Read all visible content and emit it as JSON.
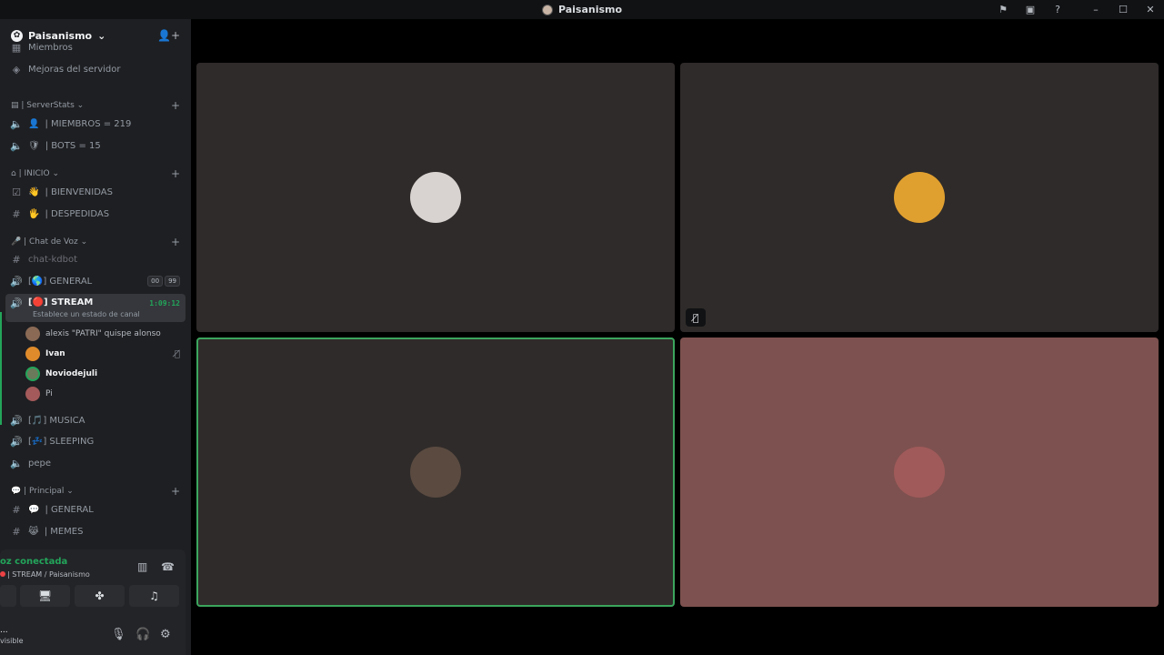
{
  "window": {
    "title": "Paisanismo"
  },
  "server": {
    "name": "Paisanismo"
  },
  "sidebar": {
    "top_partial": "Miembros",
    "boost": "Mejoras del servidor",
    "categories": [
      {
        "name": "| ServerStats",
        "channels": [
          {
            "label": "| MIEMBROS = 219",
            "emoji": "👤",
            "icon": "speaker-lock-icon"
          },
          {
            "label": "| BOTS = 15",
            "emoji": "🛡",
            "icon": "speaker-lock-icon"
          }
        ]
      },
      {
        "name": "| INICIO",
        "channels": [
          {
            "label": "| BIENVENIDAS",
            "emoji": "👋",
            "icon": "rules-icon"
          },
          {
            "label": "| DESPEDIDAS",
            "emoji": "🖐",
            "icon": "hash-icon"
          }
        ]
      },
      {
        "name": "| Chat de Voz",
        "channels": [
          {
            "label": "chat-kdbot",
            "icon": "hash-icon"
          },
          {
            "label": "[🌎] GENERAL",
            "icon": "speaker-icon",
            "badges": [
              "00",
              "99"
            ]
          },
          {
            "label": "[🔴] STREAM",
            "icon": "speaker-active-icon",
            "status": "Establece un estado de canal",
            "time": "1:09:12"
          },
          {
            "label": "[🎵] MUSICA",
            "icon": "speaker-icon"
          },
          {
            "label": "[💤] SLEEPING",
            "icon": "speaker-icon"
          },
          {
            "label": "pepe",
            "icon": "speaker-lock-icon"
          }
        ]
      },
      {
        "name": "| Principal",
        "channels": [
          {
            "label": "| GENERAL",
            "emoji": "💬",
            "icon": "hash-icon"
          },
          {
            "label": "| MEMES",
            "emoji": "😹",
            "icon": "hash-icon"
          }
        ]
      }
    ],
    "voice_members": [
      {
        "name": "alexis \"PATRI\" quispe alonso",
        "color": "#8a6a55"
      },
      {
        "name": "Ivan",
        "color": "#e08b2b",
        "muted": true
      },
      {
        "name": "Noviodejuli",
        "color": "#6a7a5a"
      },
      {
        "name": "Pi",
        "color": "#a45a5a"
      }
    ]
  },
  "voice_panel": {
    "status": "oz conectada",
    "location": "| STREAM / Paisanismo"
  },
  "user_panel": {
    "name": "...",
    "state": "visible"
  },
  "stage": {
    "tiles": [
      {
        "avatar_color": "#d8d3d0",
        "speaking": false,
        "muted": false,
        "bg": "#2f2b2a"
      },
      {
        "avatar_color": "#e0a030",
        "speaking": false,
        "muted": true,
        "bg": "#2f2b2a"
      },
      {
        "avatar_color": "#5a4a40",
        "speaking": true,
        "muted": false,
        "bg": "#2f2b2a"
      },
      {
        "avatar_color": "#a05a5a",
        "speaking": false,
        "muted": false,
        "bg": "#7d514f"
      }
    ]
  }
}
